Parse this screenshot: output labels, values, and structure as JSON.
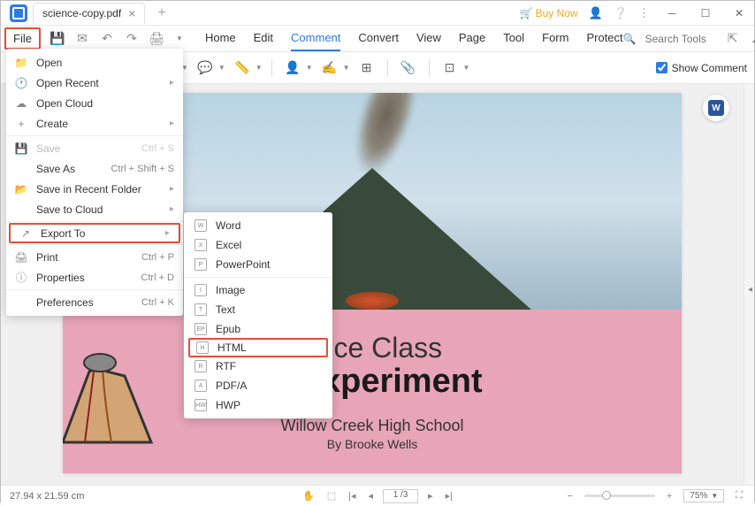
{
  "titlebar": {
    "tab_name": "science-copy.pdf",
    "buy_now": "Buy Now"
  },
  "menubar": {
    "file_label": "File",
    "tabs": [
      "Home",
      "Edit",
      "Comment",
      "Convert",
      "View",
      "Page",
      "Tool",
      "Form",
      "Protect"
    ],
    "active_tab_index": 2,
    "search_placeholder": "Search Tools"
  },
  "toolbar": {
    "show_comment": "Show Comment"
  },
  "file_menu": {
    "items": [
      {
        "label": "Open",
        "icon": "folder",
        "shortcut": "",
        "has_sub": false,
        "disabled": false
      },
      {
        "label": "Open Recent",
        "icon": "clock",
        "shortcut": "",
        "has_sub": true,
        "disabled": false
      },
      {
        "label": "Open Cloud",
        "icon": "cloud",
        "shortcut": "",
        "has_sub": false,
        "disabled": false
      },
      {
        "label": "Create",
        "icon": "plus",
        "shortcut": "",
        "has_sub": true,
        "disabled": false
      },
      {
        "label": "Save",
        "icon": "save",
        "shortcut": "Ctrl + S",
        "has_sub": false,
        "disabled": true,
        "sep_before": true
      },
      {
        "label": "Save As",
        "icon": "",
        "shortcut": "Ctrl + Shift + S",
        "has_sub": false,
        "disabled": false
      },
      {
        "label": "Save in Recent Folder",
        "icon": "folder-open",
        "shortcut": "",
        "has_sub": true,
        "disabled": false
      },
      {
        "label": "Save to Cloud",
        "icon": "",
        "shortcut": "",
        "has_sub": true,
        "disabled": false
      },
      {
        "label": "Export To",
        "icon": "export",
        "shortcut": "",
        "has_sub": true,
        "disabled": false,
        "highlighted": true,
        "sep_before": true
      },
      {
        "label": "Print",
        "icon": "print",
        "shortcut": "Ctrl + P",
        "has_sub": false,
        "disabled": false,
        "sep_before": true
      },
      {
        "label": "Properties",
        "icon": "info",
        "shortcut": "Ctrl + D",
        "has_sub": false,
        "disabled": false
      },
      {
        "label": "Preferences",
        "icon": "",
        "shortcut": "Ctrl + K",
        "has_sub": false,
        "disabled": false,
        "sep_before": true
      }
    ]
  },
  "export_menu": {
    "items": [
      {
        "label": "Word",
        "code": "W"
      },
      {
        "label": "Excel",
        "code": "X"
      },
      {
        "label": "PowerPoint",
        "code": "P"
      },
      {
        "label": "Image",
        "code": "I",
        "sep_before": true
      },
      {
        "label": "Text",
        "code": "T"
      },
      {
        "label": "Epub",
        "code": "EP"
      },
      {
        "label": "HTML",
        "code": "H",
        "highlighted": true
      },
      {
        "label": "RTF",
        "code": "R"
      },
      {
        "label": "PDF/A",
        "code": "A"
      },
      {
        "label": "HWP",
        "code": "HW"
      }
    ]
  },
  "document": {
    "title_line1": "ence Class",
    "title_line2": "ic Experiment",
    "school": "Willow Creek High School",
    "author": "By Brooke Wells",
    "word_badge": "W"
  },
  "statusbar": {
    "dimensions": "27.94 x 21.59 cm",
    "page_current": "1",
    "page_total": "3",
    "zoom": "75%"
  }
}
